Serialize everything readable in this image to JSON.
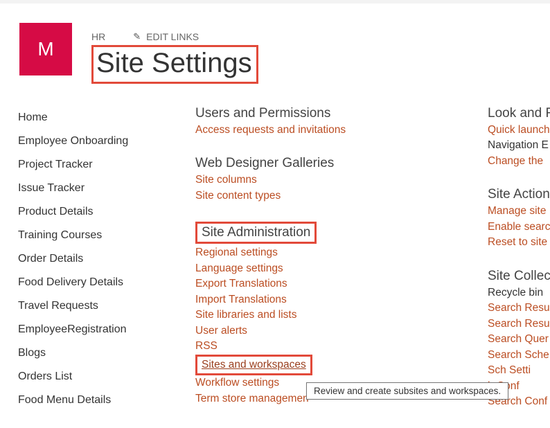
{
  "header": {
    "logo_letter": "M",
    "site_name": "HR",
    "edit_links_label": "EDIT LINKS",
    "page_title": "Site Settings"
  },
  "leftnav": [
    "Home",
    "Employee Onboarding",
    "Project Tracker",
    "Issue Tracker",
    "Product Details",
    "Training Courses",
    "Order Details",
    "Food Delivery Details",
    "Travel Requests",
    "EmployeeRegistration",
    "Blogs",
    "Orders List",
    "Food Menu Details"
  ],
  "sections": {
    "users": {
      "title": "Users and Permissions",
      "links": [
        "Access requests and invitations"
      ]
    },
    "galleries": {
      "title": "Web Designer Galleries",
      "links": [
        "Site columns",
        "Site content types"
      ]
    },
    "siteadmin": {
      "title": "Site Administration",
      "links": [
        "Regional settings",
        "Language settings",
        "Export Translations",
        "Import Translations",
        "Site libraries and lists",
        "User alerts",
        "RSS",
        "Sites and workspaces",
        "Workflow settings",
        "Term store managemen"
      ]
    },
    "lookfeel": {
      "title": "Look and F",
      "links": [
        "Quick launch",
        "Navigation E",
        "Change the"
      ]
    },
    "siteactions": {
      "title": "Site Actions",
      "links": [
        "Manage site",
        "Enable searc",
        "Reset to site"
      ]
    },
    "sitecollection": {
      "title": "Site Collect",
      "links": [
        "Recycle bin",
        "Search Resu",
        "Search Resu",
        "Search Quer",
        "Search Sche",
        "Sch Setti",
        "h Conf",
        "Search Conf"
      ]
    }
  },
  "tooltip": "Review and create subsites and workspaces."
}
